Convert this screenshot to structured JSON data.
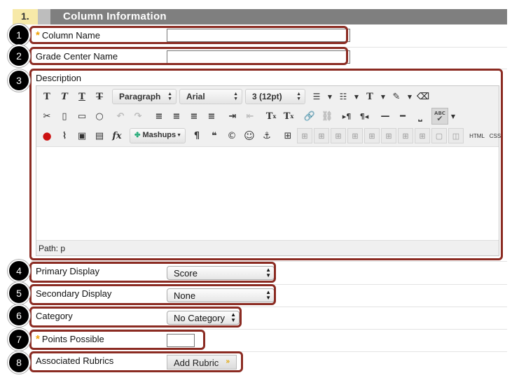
{
  "section": {
    "number": "1.",
    "title": "Column Information"
  },
  "callouts": [
    "1",
    "2",
    "3",
    "4",
    "5",
    "6",
    "7",
    "8"
  ],
  "fields": {
    "column_name": {
      "required_mark": "*",
      "label": "Column Name",
      "value": ""
    },
    "grade_center_name": {
      "label": "Grade Center Name",
      "value": ""
    },
    "description": {
      "label": "Description",
      "path_label": "Path:",
      "path_value": "p"
    },
    "primary_display": {
      "label": "Primary Display",
      "selected": "Score"
    },
    "secondary_display": {
      "label": "Secondary Display",
      "selected": "None"
    },
    "category": {
      "label": "Category",
      "selected": "No Category"
    },
    "points_possible": {
      "required_mark": "*",
      "label": "Points Possible",
      "value": ""
    },
    "associated_rubrics": {
      "label": "Associated Rubrics",
      "button": "Add Rubric",
      "button_icon": "double-chevron-down-icon"
    }
  },
  "editor_toolbar": {
    "format_dropdown": "Paragraph",
    "font_dropdown": "Arial",
    "size_dropdown": "3 (12pt)",
    "glyphs": {
      "bold": "T",
      "italic": "T",
      "underline": "T",
      "strike": "T",
      "cut": "✂",
      "copy": "🗋",
      "paste": "📋",
      "find": "🔍",
      "undo": "↶",
      "redo": "↷",
      "superscript": "T",
      "subscript": "T",
      "ltr": "▸¶",
      "rtl": "¶◂",
      "pilcrow": "¶",
      "quote": "❝",
      "copyright": "©",
      "smiley": "☺",
      "anchor": "⚓",
      "html": "HTML",
      "css": "CSS",
      "mashups": "Mashups",
      "fx": "fx",
      "spellcheck": "ABC"
    }
  },
  "colors": {
    "header_bg": "#7f7f7f",
    "number_bg": "#f7e9a8",
    "highlight": "#8b2b22",
    "required": "#f0a000"
  }
}
